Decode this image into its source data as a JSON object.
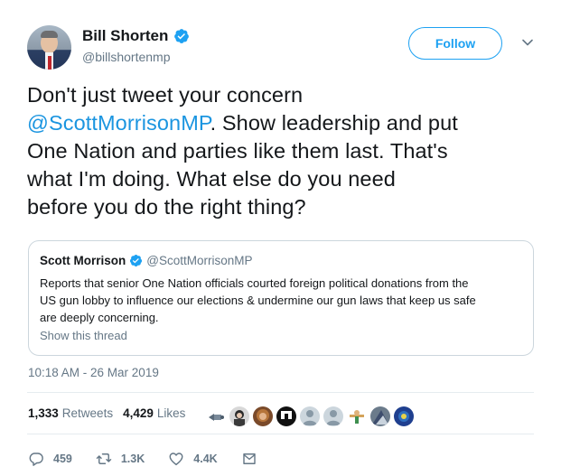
{
  "author": {
    "name": "Bill Shorten",
    "handle": "@billshortenmp"
  },
  "follow_label": "Follow",
  "tweet": {
    "line1": "Don't just tweet your concern",
    "mention": "@ScottMorrisonMP",
    "line2_rest": ". Show leadership and put",
    "line3": "One Nation and parties like them last. That's",
    "line4": "what I'm doing. What else do you need",
    "line5": "before you do the right thing?"
  },
  "quoted": {
    "name": "Scott Morrison",
    "handle": "@ScottMorrisonMP",
    "line1": "Reports that senior One Nation officials courted foreign political donations from the",
    "line2": "US gun lobby to influence our elections & undermine our gun laws that keep us safe",
    "line3": "are deeply concerning.",
    "thread_label": "Show this thread"
  },
  "timestamp": "10:18 AM - 26 Mar 2019",
  "stats": {
    "retweets_count": "1,333",
    "retweets_label": "Retweets",
    "likes_count": "4,429",
    "likes_label": "Likes"
  },
  "actions": {
    "replies": "459",
    "retweets": "1.3K",
    "likes": "4.4K"
  },
  "colors": {
    "accent": "#1da1f2",
    "mention": "#1b95e0",
    "secondary_text": "#657786",
    "border": "#ccd6dd"
  },
  "icons": {
    "verified": "verified-badge-icon",
    "caret": "chevron-down-icon",
    "reply": "reply-icon",
    "retweet": "retweet-icon",
    "like": "heart-icon",
    "dm": "envelope-icon"
  }
}
